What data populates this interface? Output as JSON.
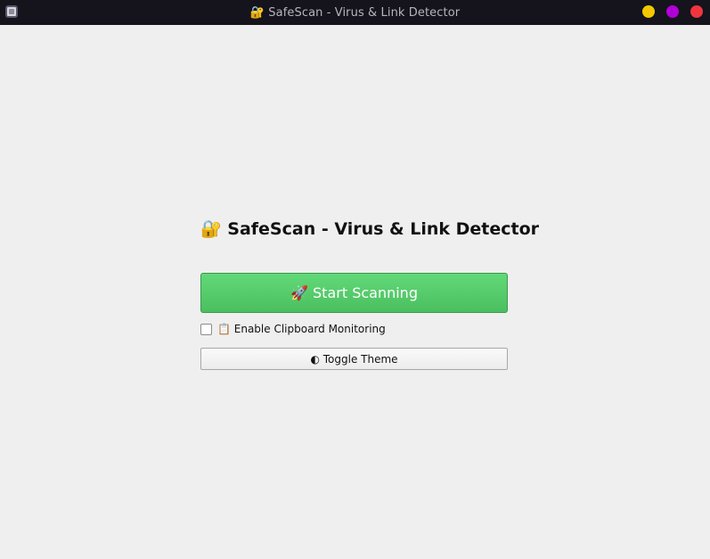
{
  "window": {
    "title": "🔐 SafeScan - Virus & Link Detector",
    "app_icon": "app-window-icon",
    "controls": {
      "minimize_color": "#f3c800",
      "maximize_color": "#b100d6",
      "close_color": "#f0353e"
    }
  },
  "main": {
    "heading": "🔐 SafeScan - Virus & Link Detector",
    "start_button": {
      "label": "🚀 Start Scanning",
      "color": "#4bbf5f"
    },
    "clipboard_monitoring": {
      "label": "📋 Enable Clipboard Monitoring",
      "checked": false
    },
    "toggle_theme_button": {
      "label": "◐ Toggle Theme"
    }
  }
}
